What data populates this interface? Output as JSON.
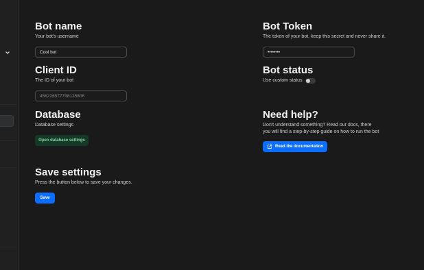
{
  "bot_name": {
    "title": "Bot name",
    "subtitle": "Your bot's username",
    "value": "Cool bot"
  },
  "bot_token": {
    "title": "Bot Token",
    "subtitle": "The token of your bot, keep this secret and never share it.",
    "value": "••••••••"
  },
  "client_id": {
    "title": "Client ID",
    "subtitle": "The ID of your bot",
    "value": "456226577798135808"
  },
  "bot_status": {
    "title": "Bot status",
    "toggle_label": "Use custom status",
    "enabled": false
  },
  "database": {
    "title": "Database",
    "subtitle": "Database settings",
    "button_label": "Open database settings"
  },
  "help": {
    "title": "Need help?",
    "text": "Don't understand something? Read our docs, there you will find a step-by-step guide on how to run the bot",
    "button_label": "Read the documentation",
    "button_icon": "external-link-icon"
  },
  "save": {
    "title": "Save settings",
    "subtitle": "Press the button below to save your changes.",
    "button_label": "Save"
  },
  "colors": {
    "background": "#1a1a1b",
    "accent": "#0d6efd",
    "db_button_bg": "#143a26",
    "db_button_text": "#8fd1a6"
  }
}
